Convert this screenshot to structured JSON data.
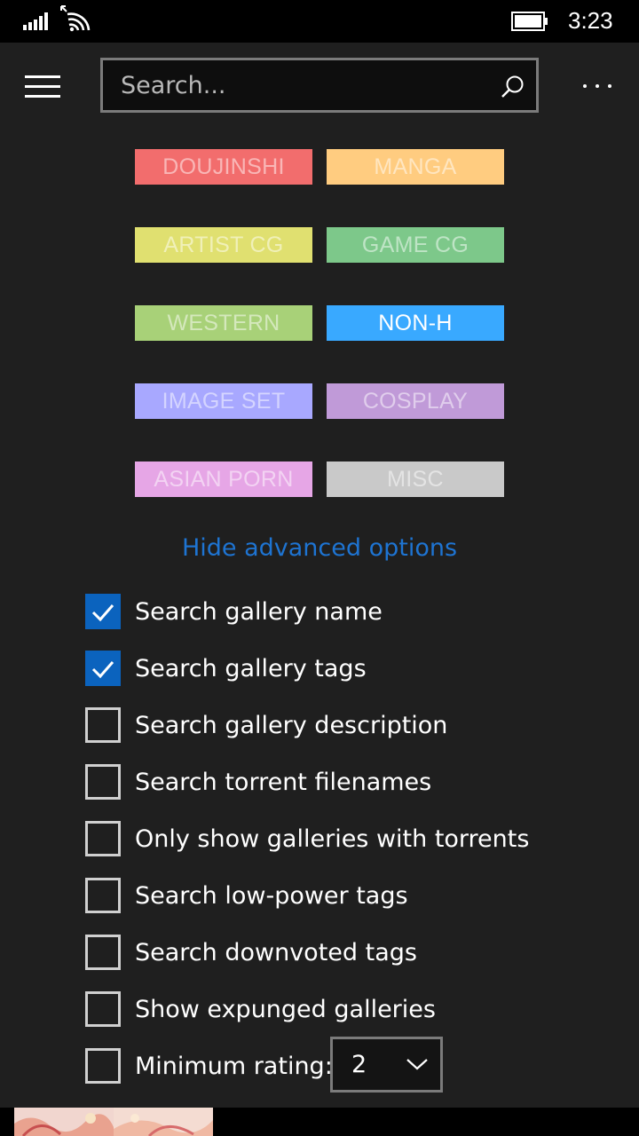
{
  "status_bar": {
    "time": "3:23",
    "signal_icon": "signal-bars-icon",
    "wifi_icon": "wifi-icon",
    "battery_icon": "battery-icon"
  },
  "header": {
    "menu_icon": "hamburger-icon",
    "search_placeholder": "Search...",
    "search_value": "",
    "search_icon": "search-icon",
    "more_icon": "more-icon"
  },
  "categories": [
    {
      "label": "DOUJINSHI",
      "color": "#f26d6d",
      "active": false
    },
    {
      "label": "MANGA",
      "color": "#ffcc80",
      "active": false
    },
    {
      "label": "ARTIST CG",
      "color": "#e0e070",
      "active": false
    },
    {
      "label": "GAME CG",
      "color": "#7dc88a",
      "active": false
    },
    {
      "label": "WESTERN",
      "color": "#a8d178",
      "active": false
    },
    {
      "label": "NON-H",
      "color": "#39a9ff",
      "active": true
    },
    {
      "label": "IMAGE SET",
      "color": "#a8a8ff",
      "active": false
    },
    {
      "label": "COSPLAY",
      "color": "#c09ad8",
      "active": false
    },
    {
      "label": "ASIAN PORN",
      "color": "#e6a6e6",
      "active": false
    },
    {
      "label": "MISC",
      "color": "#c9c9c9",
      "active": false
    }
  ],
  "advanced_toggle": "Hide advanced options",
  "options": [
    {
      "label": "Search gallery name",
      "checked": true
    },
    {
      "label": "Search gallery tags",
      "checked": true
    },
    {
      "label": "Search gallery description",
      "checked": false
    },
    {
      "label": "Search torrent filenames",
      "checked": false
    },
    {
      "label": "Only show galleries with torrents",
      "checked": false
    },
    {
      "label": "Search low-power tags",
      "checked": false
    },
    {
      "label": "Search downvoted tags",
      "checked": false
    },
    {
      "label": "Show expunged galleries",
      "checked": false
    },
    {
      "label": "Minimum rating:",
      "checked": false
    }
  ],
  "minimum_rating": {
    "value": "2",
    "icon": "chevron-down-icon"
  },
  "colors": {
    "accent": "#0b63be",
    "link": "#1e74d2",
    "background": "#1f1f1f"
  }
}
